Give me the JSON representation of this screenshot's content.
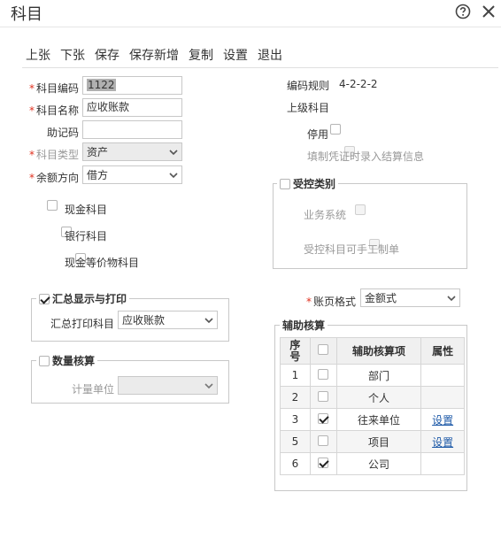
{
  "window": {
    "title": "科目"
  },
  "toolbar": {
    "items": [
      "上张",
      "下张",
      "保存",
      "保存新增",
      "复制",
      "设置",
      "退出"
    ]
  },
  "form": {
    "code_label": "科目编码",
    "code_value": "1122",
    "name_label": "科目名称",
    "name_value": "应收账款",
    "mnemonic_label": "助记码",
    "mnemonic_value": "",
    "type_label": "科目类型",
    "type_value": "资产",
    "balance_label": "余额方向",
    "balance_value": "借方",
    "coding_rule_label": "编码规则",
    "coding_rule_value": "4-2-2-2",
    "parent_label": "上级科目",
    "parent_value": "",
    "disable_label": "停用",
    "settlement_label": "填制凭证时录入结算信息",
    "cash_label": "现金科目",
    "bank_label": "银行科目",
    "cash_equiv_label": "现金等价物科目"
  },
  "controlled": {
    "title": "受控类别",
    "business_label": "业务系统",
    "manual_label": "受控科目可手工制单"
  },
  "summary": {
    "title": "汇总显示与打印",
    "print_label": "汇总打印科目",
    "print_value": "应收账款"
  },
  "quantity": {
    "title": "数量核算",
    "unit_label": "计量单位",
    "unit_value": ""
  },
  "ledger": {
    "label": "账页格式",
    "value": "金额式"
  },
  "aux": {
    "title": "辅助核算",
    "headers": {
      "seq": "序号",
      "item": "辅助核算项",
      "attr": "属性"
    },
    "rows": [
      {
        "seq": "1",
        "checked": false,
        "item": "部门",
        "attr": ""
      },
      {
        "seq": "2",
        "checked": false,
        "item": "个人",
        "attr": ""
      },
      {
        "seq": "3",
        "checked": true,
        "item": "往来单位",
        "attr": "设置"
      },
      {
        "seq": "5",
        "checked": false,
        "item": "项目",
        "attr": "设置"
      },
      {
        "seq": "6",
        "checked": true,
        "item": "公司",
        "attr": ""
      }
    ]
  }
}
